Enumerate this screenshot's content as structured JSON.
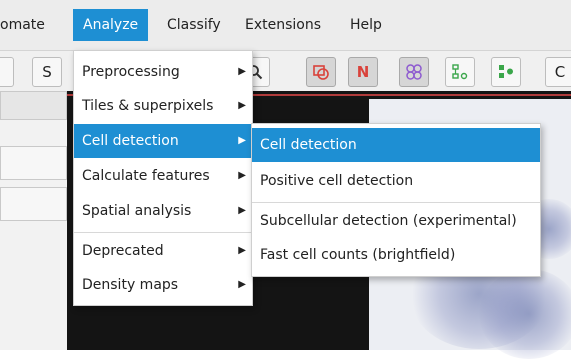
{
  "menubar": {
    "items": [
      "omate",
      "Analyze",
      "Classify",
      "Extensions",
      "Help"
    ],
    "active_index": 1
  },
  "toolbar": {
    "buttons": [
      {
        "label": "S",
        "icon": "s-letter",
        "pressed": false
      },
      {
        "label": "",
        "icon": "zoom-icon",
        "pressed": false
      },
      {
        "label": "",
        "icon": "show-annotations-icon",
        "pressed": true,
        "color": "#d9423b"
      },
      {
        "label": "N",
        "icon": "n-letter",
        "pressed": true,
        "color": "#d9423b"
      },
      {
        "label": "",
        "icon": "cells-icon",
        "pressed": true,
        "color": "#8e5bd0"
      },
      {
        "label": "",
        "icon": "tma-grid-icon",
        "pressed": false,
        "color": "#3aa64a"
      },
      {
        "label": "",
        "icon": "detections-icon",
        "pressed": false,
        "color": "#3aa64a"
      },
      {
        "label": "C",
        "icon": "c-letter",
        "pressed": false
      }
    ]
  },
  "analyze_menu": {
    "groups": [
      [
        {
          "label": "Preprocessing",
          "submenu": true
        },
        {
          "label": "Tiles & superpixels",
          "submenu": true
        },
        {
          "label": "Cell detection",
          "submenu": true,
          "highlight": true
        },
        {
          "label": "Calculate features",
          "submenu": true
        },
        {
          "label": "Spatial analysis",
          "submenu": true
        }
      ],
      [
        {
          "label": "Deprecated",
          "submenu": true
        },
        {
          "label": "Density maps",
          "submenu": true
        }
      ]
    ]
  },
  "cell_detection_submenu": {
    "groups": [
      [
        {
          "label": "Cell detection",
          "highlight": true
        },
        {
          "label": "Positive cell detection"
        }
      ],
      [
        {
          "label": "Subcellular detection (experimental)"
        },
        {
          "label": "Fast cell counts (brightfield)"
        }
      ]
    ]
  },
  "colors": {
    "accent": "#1e8fd3",
    "menubar_bg": "#ececec",
    "viewer_bg": "#141414"
  }
}
